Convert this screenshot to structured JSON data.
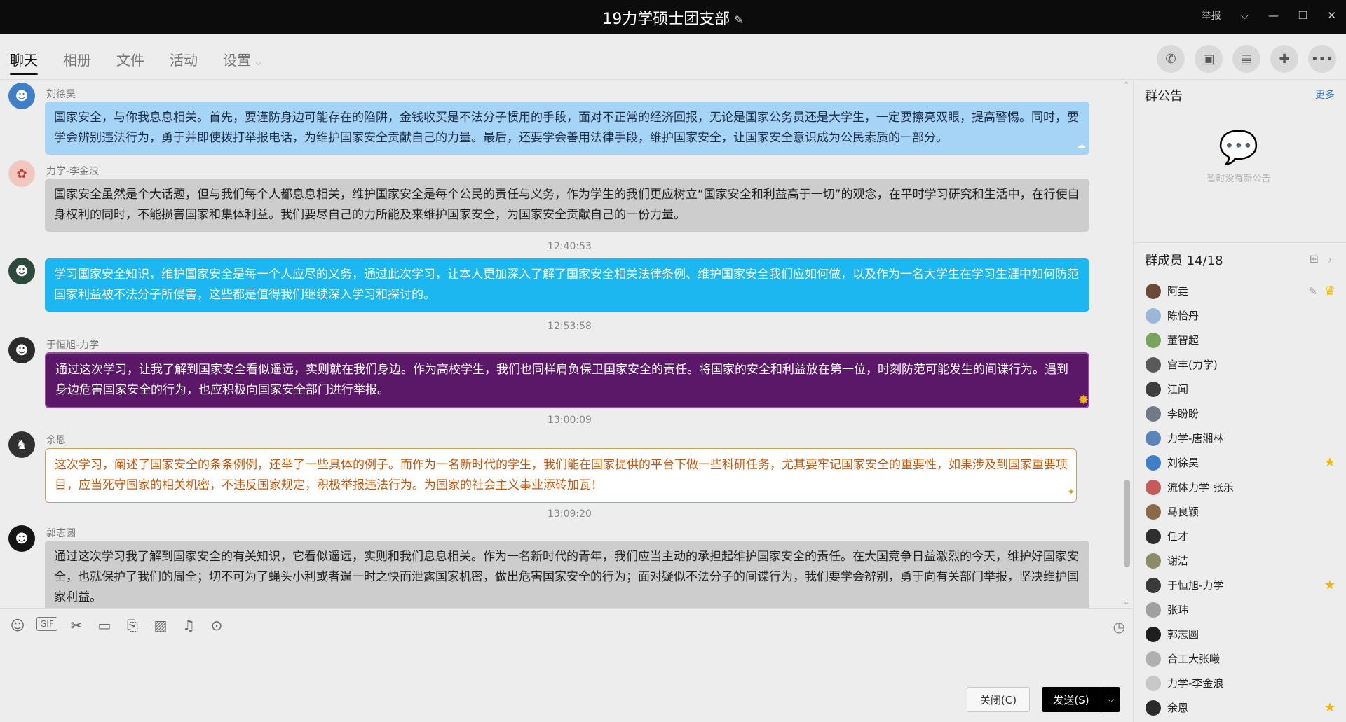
{
  "window": {
    "title": "19力学硕士团支部",
    "report_label": "举报",
    "icons": [
      "edit-icon",
      "chevron-down-icon",
      "minimize-icon",
      "restore-icon",
      "close-icon"
    ]
  },
  "nav": {
    "tabs": [
      {
        "label": "聊天",
        "active": true
      },
      {
        "label": "相册"
      },
      {
        "label": "文件"
      },
      {
        "label": "活动"
      },
      {
        "label": "设置"
      }
    ],
    "tool_icons": [
      "phone-icon",
      "video-icon",
      "screen-share-icon",
      "add-app-icon",
      "more-icon"
    ]
  },
  "messages": [
    {
      "sender": "刘徐昊",
      "style": "lightblue",
      "text": "国家安全，与你我息息相关。首先，要谨防身边可能存在的陷阱，金钱收买是不法分子惯用的手段，面对不正常的经济回报，无论是国家公务员还是大学生，一定要擦亮双眼，提高警惕。同时，要学会辨别违法行为，勇于并即使拨打举报电话，为维护国家安全贡献自己的力量。最后，还要学会善用法律手段，维护国家安全，让国家安全意识成为公民素质的一部分。"
    },
    {
      "sender": "力学-李金浪",
      "style": "gray",
      "text": "国家安全虽然是个大话题，但与我们每个人都息息相关，维护国家安全是每个公民的责任与义务，作为学生的我们更应树立“国家安全和利益高于一切”的观念，在平时学习研究和生活中，在行使自身权利的同时，不能损害国家和集体利益。我们要尽自己的力所能及来维护国家安全，为国家安全贡献自己的一份力量。"
    },
    {
      "timestamp": "12:40:53",
      "sender": "",
      "style": "cyan",
      "text": "学习国家安全知识，维护国家安全是每一个人应尽的义务，通过此次学习，让本人更加深入了解了国家安全相关法律条例、维护国家安全我们应如何做，以及作为一名大学生在学习生涯中如何防范国家利益被不法分子所侵害，这些都是值得我们继续深入学习和探讨的。"
    },
    {
      "timestamp": "12:53:58",
      "sender": "于恒旭-力学",
      "style": "purple",
      "text": "通过这次学习，让我了解到国家安全看似遥远，实则就在我们身边。作为高校学生，我们也同样肩负保卫国家安全的责任。将国家的安全和利益放在第一位，时刻防范可能发生的间谍行为。遇到身边危害国家安全的行为，也应积极向国家安全部门进行举报。"
    },
    {
      "timestamp": "13:00:09",
      "sender": "余恩",
      "style": "white",
      "text": "这次学习，阐述了国家安全的条条例例，还举了一些具体的例子。而作为一名新时代的学生，我们能在国家提供的平台下做一些科研任务，尤其要牢记国家安全的重要性，如果涉及到国家重要项目，应当死守国家的相关机密，不违反国家规定，积极举报违法行为。为国家的社会主义事业添砖加瓦！"
    },
    {
      "timestamp": "13:09:20",
      "sender": "郭志圆",
      "style": "gray",
      "text": "通过这次学习我了解到国家安全的有关知识，它看似遥远，实则和我们息息相关。作为一名新时代的青年，我们应当主动的承担起维护国家安全的责任。在大国竞争日益激烈的今天，维护好国家安全，也就保护了我们的周全；切不可为了蝇头小利或者逞一时之快而泄露国家机密，做出危害国家安全的行为；面对疑似不法分子的间谍行为，我们要学会辨别，勇于向有关部门举报，坚决维护国家利益。"
    }
  ],
  "input": {
    "tool_icons": [
      "emoji-icon",
      "gif-icon",
      "scissors-icon",
      "folder-icon",
      "red-packet-icon",
      "image-icon",
      "bell-icon",
      "more-circle-icon"
    ],
    "close_label": "关闭(C)",
    "send_label": "发送(S)"
  },
  "notice": {
    "title": "群公告",
    "more": "更多",
    "empty_text": "暂时没有新公告"
  },
  "members": {
    "title": "群成员 14/18",
    "list": [
      {
        "name": "阿垚",
        "color": "#6b4a3a",
        "owner": true
      },
      {
        "name": "陈怡丹",
        "color": "#9ab7d8"
      },
      {
        "name": "董智超",
        "color": "#7aa35f"
      },
      {
        "name": "宫丰(力学)",
        "color": "#5a5a5a"
      },
      {
        "name": "江闻",
        "color": "#3e3e3e"
      },
      {
        "name": "李盼盼",
        "color": "#6f7a86"
      },
      {
        "name": "力学-唐湘林",
        "color": "#5b85b8"
      },
      {
        "name": "刘徐昊",
        "color": "#3f7fc7",
        "star": true
      },
      {
        "name": "流体力学 张乐",
        "color": "#c55a5a"
      },
      {
        "name": "马良颖",
        "color": "#8a6a4a"
      },
      {
        "name": "任才",
        "color": "#2f2f2f"
      },
      {
        "name": "谢洁",
        "color": "#8c8c6a"
      },
      {
        "name": "于恒旭-力学",
        "color": "#3a3a3a",
        "star": true
      },
      {
        "name": "张玮",
        "color": "#a0a0a0"
      },
      {
        "name": "郭志圆",
        "color": "#1f1f1f"
      },
      {
        "name": "合工大张曦",
        "color": "#b0b0b0"
      },
      {
        "name": "力学-李金浪",
        "color": "#c8c8c8"
      },
      {
        "name": "余恩",
        "color": "#2a2a2a",
        "star": true
      }
    ]
  }
}
